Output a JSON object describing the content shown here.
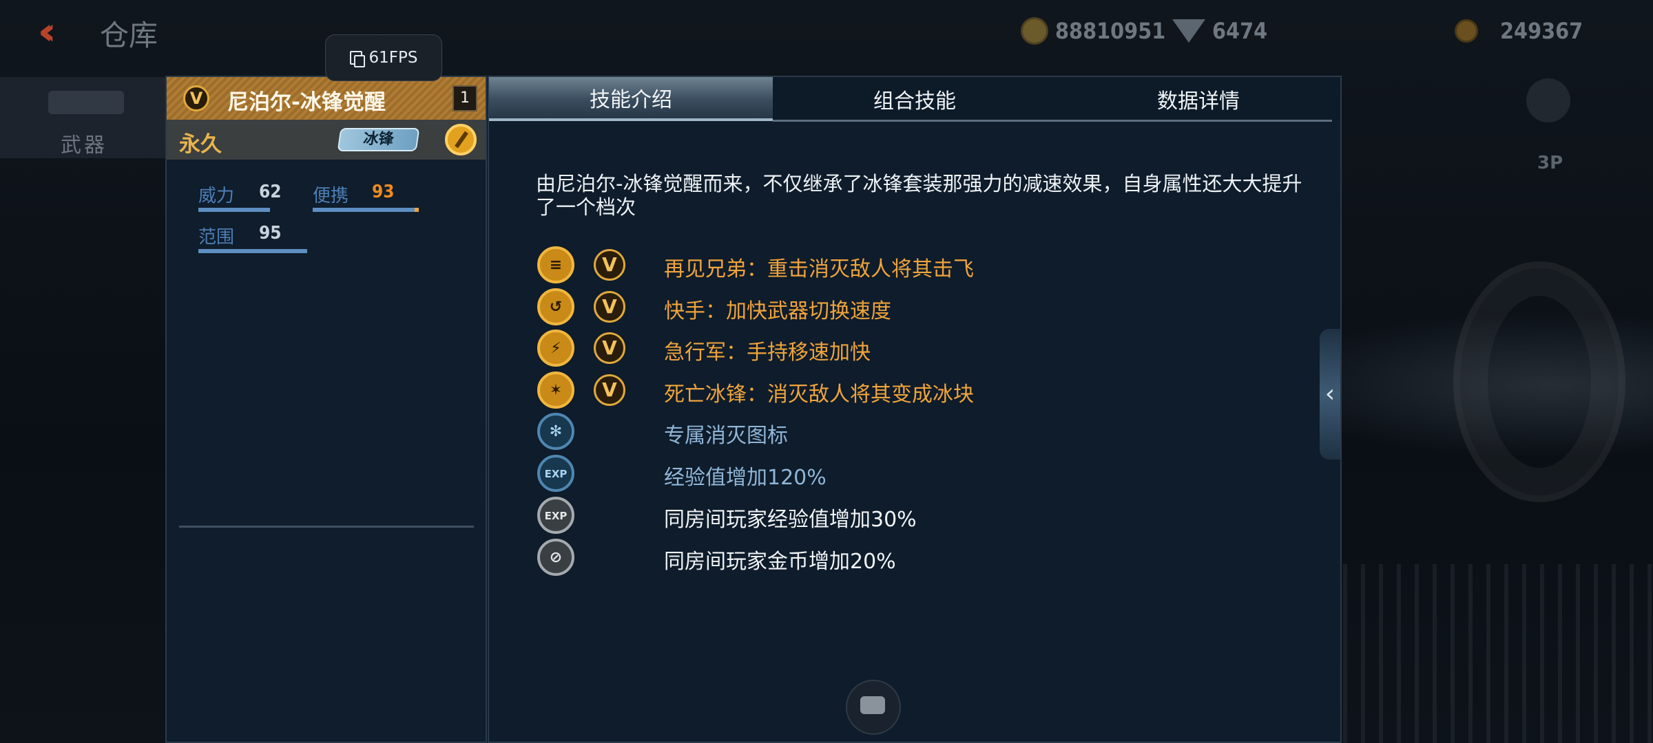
{
  "topbar": {
    "title": "仓库",
    "currency1_value": "88810951",
    "currency2_value": "6474",
    "currency3_value": "249367"
  },
  "sidenav": {
    "label": "武器"
  },
  "fps": {
    "label": "61FPS"
  },
  "weapon": {
    "badge": "V",
    "name": "尼泊尔-冰锋觉醒",
    "level": "1",
    "duration": "永久",
    "tag": "冰锋",
    "stats": [
      {
        "label": "威力",
        "value": "62",
        "fill": 0.62
      },
      {
        "label": "便携",
        "value": "93",
        "fill": 0.93
      },
      {
        "label": "范围",
        "value": "95",
        "fill": 0.95
      }
    ]
  },
  "tabs": [
    {
      "label": "技能介绍",
      "active": true
    },
    {
      "label": "组合技能",
      "active": false
    },
    {
      "label": "数据详情",
      "active": false
    }
  ],
  "description": "由尼泊尔-冰锋觉醒而来，不仅继承了冰锋套装那强力的减速效果，自身属性还大大提升了一个档次",
  "skills": [
    {
      "icon": "kick-icon",
      "v_badge": "V",
      "text": "再见兄弟：重击消灭敌人将其击飞",
      "color": "#f0a43a"
    },
    {
      "icon": "swap-hand-icon",
      "v_badge": "V",
      "text": "快手：加快武器切换速度",
      "color": "#f0a43a"
    },
    {
      "icon": "running-icon",
      "v_badge": "V",
      "text": "急行军：手持移速加快",
      "color": "#f0a43a"
    },
    {
      "icon": "freeze-skull-icon",
      "v_badge": "V",
      "text": "死亡冰锋：消灭敌人将其变成冰块",
      "color": "#f0a43a"
    },
    {
      "icon": "snowflake-icon",
      "v_badge": "",
      "text": "专属消灭图标",
      "color": "#90b6d8"
    },
    {
      "icon": "exp-icon",
      "v_badge": "",
      "text": "经验值增加120%",
      "color": "#90b6d8"
    },
    {
      "icon": "room-exp-icon",
      "v_badge": "",
      "text": "同房间玩家经验值增加30%",
      "color": "#f2f4f6"
    },
    {
      "icon": "room-coin-icon",
      "v_badge": "",
      "text": "同房间玩家金币增加20%",
      "color": "#f2f4f6"
    }
  ],
  "view_mode": "3P",
  "colors": {
    "accent_gold": "#f0a43a",
    "panel_bg": "#0e1c2b",
    "stat_bar": "#5e8fc2",
    "value_orange": "#f08a1c"
  }
}
